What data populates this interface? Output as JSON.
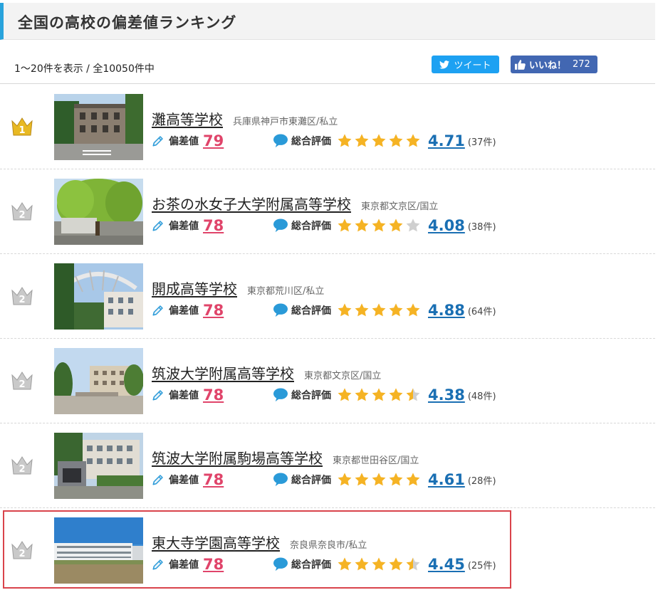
{
  "header": {
    "title": "全国の高校の偏差値ランキング"
  },
  "count_text": "1〜20件を表示 / 全10050件中",
  "social": {
    "tweet_label": "ツイート",
    "like_label": "いいね！",
    "like_count": "272"
  },
  "labels": {
    "hensachi": "偏差値",
    "rating": "総合評価"
  },
  "colors": {
    "accent": "#29a3dc",
    "hensachi": "#e0446a",
    "score": "#1a6fb3",
    "star": "#f5b324",
    "highlight": "#d9434b"
  },
  "schools": [
    {
      "rank": "1",
      "name": "灘高等学校",
      "location": "兵庫県神戸市東灘区/私立",
      "hensachi": "79",
      "stars": 4.71,
      "score": "4.71",
      "reviews": "(37件)"
    },
    {
      "rank": "2",
      "name": "お茶の水女子大学附属高等学校",
      "location": "東京都文京区/国立",
      "hensachi": "78",
      "stars": 4.08,
      "score": "4.08",
      "reviews": "(38件)"
    },
    {
      "rank": "2",
      "name": "開成高等学校",
      "location": "東京都荒川区/私立",
      "hensachi": "78",
      "stars": 4.88,
      "score": "4.88",
      "reviews": "(64件)"
    },
    {
      "rank": "2",
      "name": "筑波大学附属高等学校",
      "location": "東京都文京区/国立",
      "hensachi": "78",
      "stars": 4.38,
      "score": "4.38",
      "reviews": "(48件)"
    },
    {
      "rank": "2",
      "name": "筑波大学附属駒場高等学校",
      "location": "東京都世田谷区/国立",
      "hensachi": "78",
      "stars": 4.61,
      "score": "4.61",
      "reviews": "(28件)"
    },
    {
      "rank": "2",
      "name": "東大寺学園高等学校",
      "location": "奈良県奈良市/私立",
      "hensachi": "78",
      "stars": 4.45,
      "score": "4.45",
      "reviews": "(25件)"
    }
  ]
}
